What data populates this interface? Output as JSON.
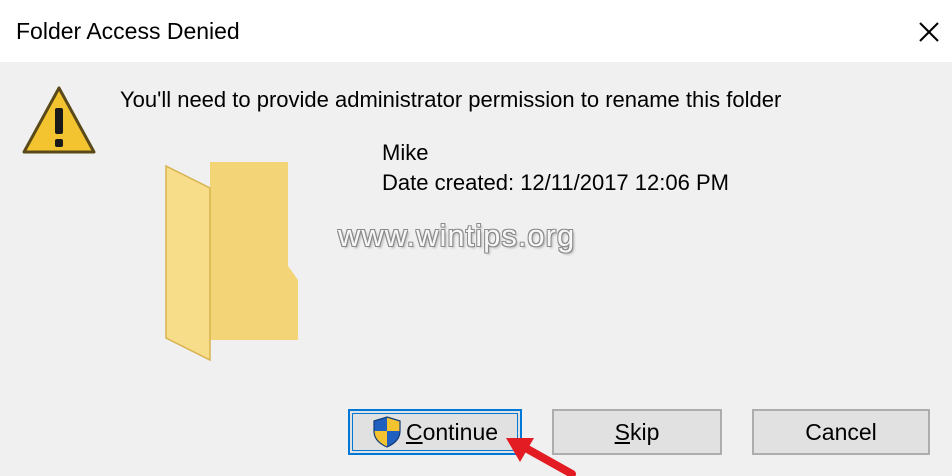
{
  "window": {
    "title": "Folder Access Denied",
    "close_icon": "close-icon"
  },
  "message": {
    "text": "You'll need to provide administrator permission to rename this folder",
    "icon": "warning-icon"
  },
  "folder": {
    "icon": "folder-icon",
    "name": "Mike",
    "date_created": "Date created: 12/11/2017 12:06 PM"
  },
  "watermark": "www.wintips.org",
  "buttons": {
    "continue": {
      "prefix": "C",
      "rest": "ontinue",
      "icon": "uac-shield-icon"
    },
    "skip": {
      "prefix": "S",
      "rest": "kip"
    },
    "cancel": {
      "label": "Cancel"
    }
  },
  "colors": {
    "accent": "#0078d7",
    "warning": "#f4c430",
    "folder": "#f3d476",
    "arrow": "#e31b23"
  }
}
